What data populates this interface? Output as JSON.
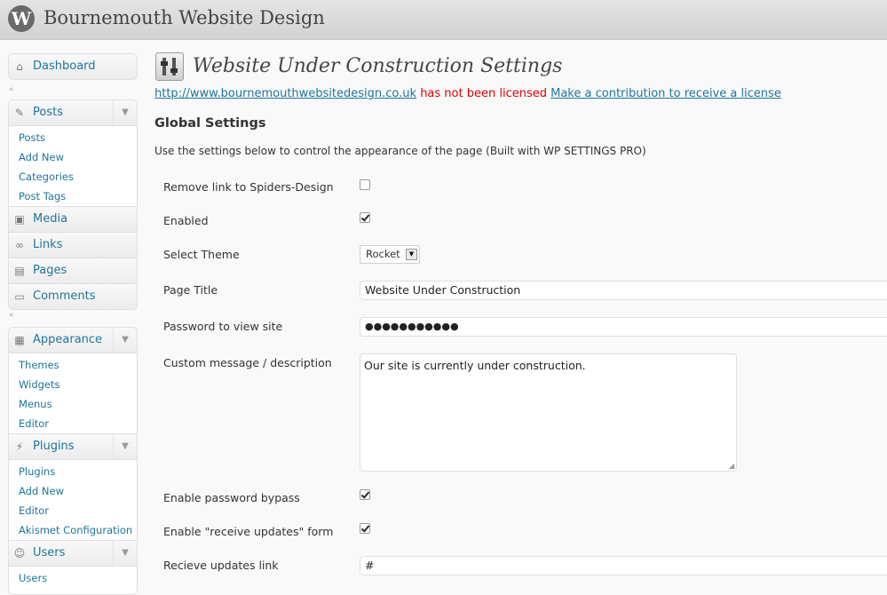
{
  "header": {
    "logo_glyph": "W",
    "site_title": "Bournemouth Website Design"
  },
  "sidebar": {
    "dashboard": {
      "label": "Dashboard",
      "icon": "home-icon"
    },
    "posts": {
      "label": "Posts",
      "icon": "pushpin-icon",
      "items": [
        "Posts",
        "Add New",
        "Categories",
        "Post Tags"
      ]
    },
    "media": {
      "label": "Media",
      "icon": "camera-icon"
    },
    "links": {
      "label": "Links",
      "icon": "link-icon"
    },
    "pages": {
      "label": "Pages",
      "icon": "pages-icon"
    },
    "comments": {
      "label": "Comments",
      "icon": "speech-bubble-icon"
    },
    "appearance": {
      "label": "Appearance",
      "icon": "appearance-icon",
      "items": [
        "Themes",
        "Widgets",
        "Menus",
        "Editor"
      ]
    },
    "plugins": {
      "label": "Plugins",
      "icon": "plug-icon",
      "items": [
        "Plugins",
        "Add New",
        "Editor",
        "Akismet Configuration"
      ]
    },
    "users": {
      "label": "Users",
      "icon": "users-icon",
      "items": [
        "Users"
      ]
    }
  },
  "main": {
    "page_title": "Website Under Construction Settings",
    "page_icon": "settings-sliders-icon",
    "license": {
      "site_url": "http://www.bournemouthwebsitedesign.co.uk",
      "status_text": "has not been licensed",
      "contribution_link": "Make a contribution to receive a license"
    },
    "section_title": "Global Settings",
    "section_description": "Use the settings below to control the appearance of the page (Built with WP SETTINGS PRO)",
    "fields": {
      "remove_link": {
        "label": "Remove link to Spiders-Design",
        "checked": false
      },
      "enabled": {
        "label": "Enabled",
        "checked": true
      },
      "theme": {
        "label": "Select Theme",
        "value": "Rocket"
      },
      "page_title": {
        "label": "Page Title",
        "value": "Website Under Construction"
      },
      "password": {
        "label": "Password to view site",
        "value": "●●●●●●●●●●●"
      },
      "message": {
        "label": "Custom message / description",
        "value": "Our site is currently under construction."
      },
      "password_bypass": {
        "label": "Enable password bypass",
        "checked": true
      },
      "receive_updates_form": {
        "label": "Enable \"receive updates\" form",
        "checked": true
      },
      "updates_link": {
        "label": "Recieve updates link",
        "value": "#"
      }
    }
  },
  "colors": {
    "link": "#21759b",
    "warning": "#dd0000",
    "header_bg": "#dcdcdc"
  }
}
